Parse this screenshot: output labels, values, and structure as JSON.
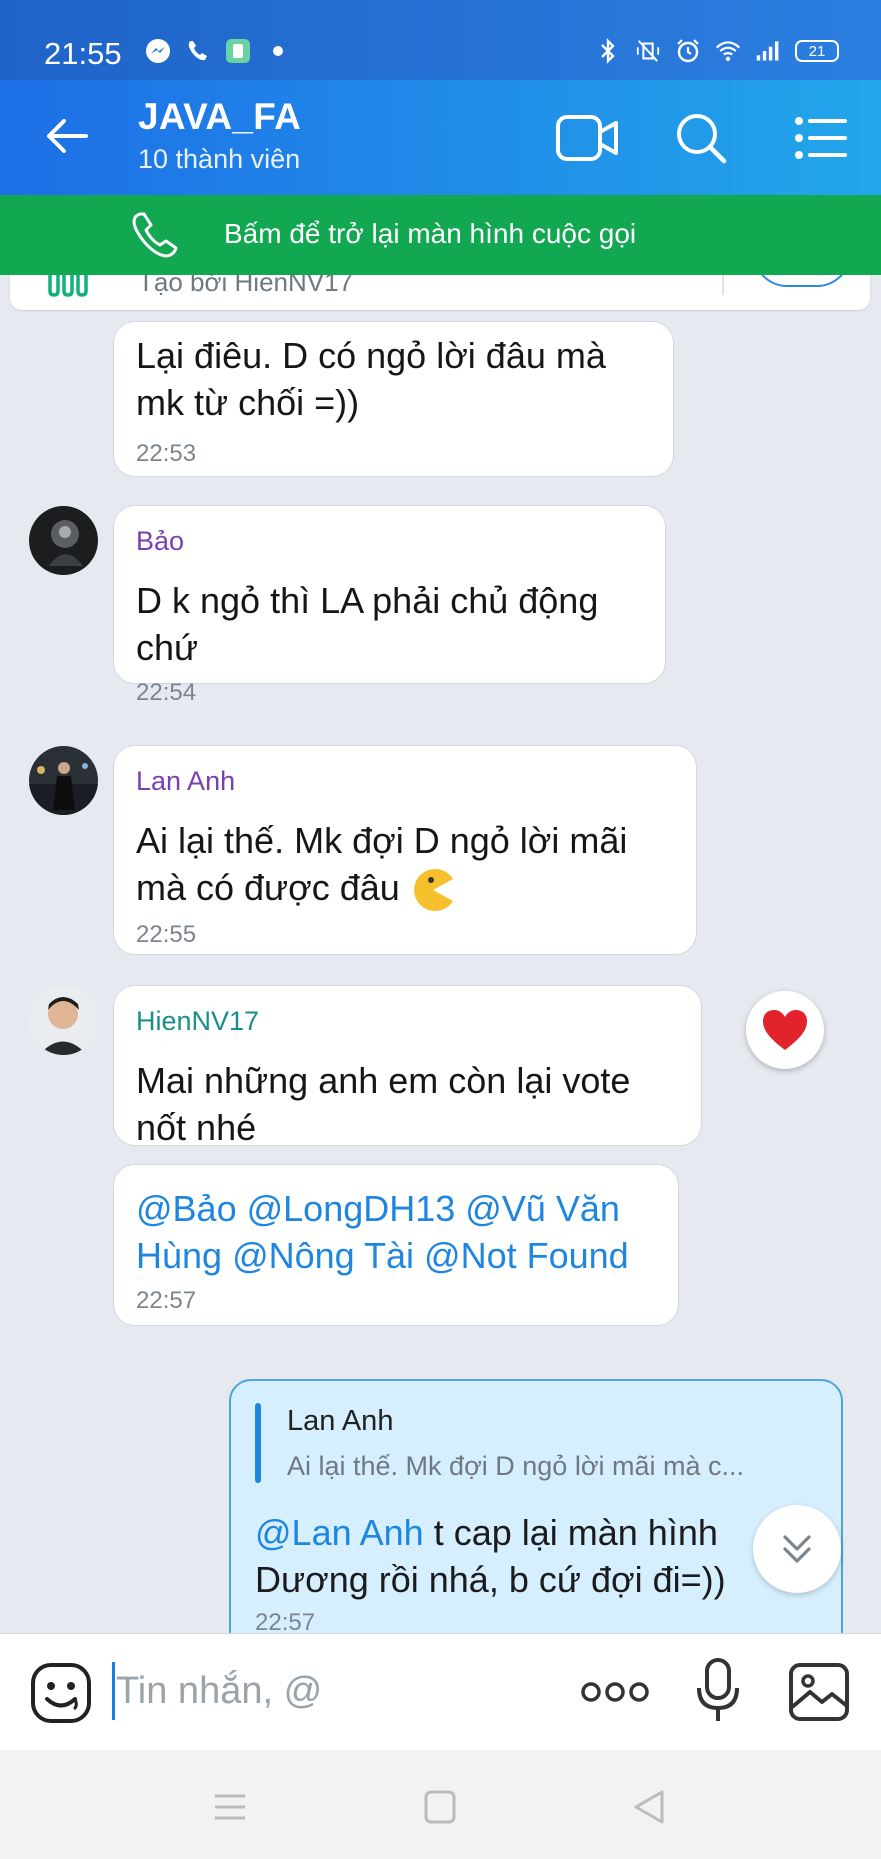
{
  "status_bar": {
    "time": "21:55",
    "left_icons": [
      "messenger-icon",
      "phone-call-icon",
      "app-notification-icon",
      "dot-icon"
    ],
    "right_icons": [
      "bluetooth-icon",
      "mute-vibrate-icon",
      "alarm-icon",
      "wifi-icon",
      "signal-icon"
    ],
    "battery": "21"
  },
  "header": {
    "group_name": "JAVA_FA",
    "member_count": "10 thành viên",
    "colors": {
      "gradient_start": "#1e6fe6",
      "gradient_end": "#22a6ea"
    }
  },
  "call_banner": {
    "text": "Bấm để trở lại màn hình cuộc gọi",
    "color": "#12a852"
  },
  "poll": {
    "creator": "Tạo bởi HienNV17"
  },
  "messages": [
    {
      "id": "m1",
      "sender": "",
      "text": "Lại điêu. D có ngỏ lời đâu mà mk từ chối =))",
      "time": "22:53"
    },
    {
      "id": "m2",
      "sender": "Bảo",
      "sender_color": "#7b3fb0",
      "text": "D k ngỏ thì LA phải chủ động chứ",
      "time": "22:54"
    },
    {
      "id": "m3",
      "sender": "Lan Anh",
      "sender_color": "#7b3fb0",
      "text": "Ai lại thế. Mk đợi D ngỏ lời mãi mà có được đâu",
      "emoji": "pacman-emoji",
      "time": "22:55"
    },
    {
      "id": "m4",
      "sender": "HienNV17",
      "sender_color": "#1a8f8a",
      "text": "Mai những anh em còn lại vote nốt nhé",
      "reaction": "heart-icon"
    },
    {
      "id": "m5",
      "mentions": "@Bảo @LongDH13 @Vũ Văn Hùng @Nông Tài @Not Found",
      "time": "22:57"
    }
  ],
  "my_reply": {
    "quote_author": "Lan Anh",
    "quote_text": "Ai lại thế. Mk đợi D ngỏ lời mãi mà c...",
    "mention": "@Lan Anh",
    "text": " t cap lại màn hình Dương rồi nhá, b cứ đợi đi=))",
    "time": "22:57"
  },
  "composer": {
    "placeholder": "Tin nhắn, @"
  }
}
